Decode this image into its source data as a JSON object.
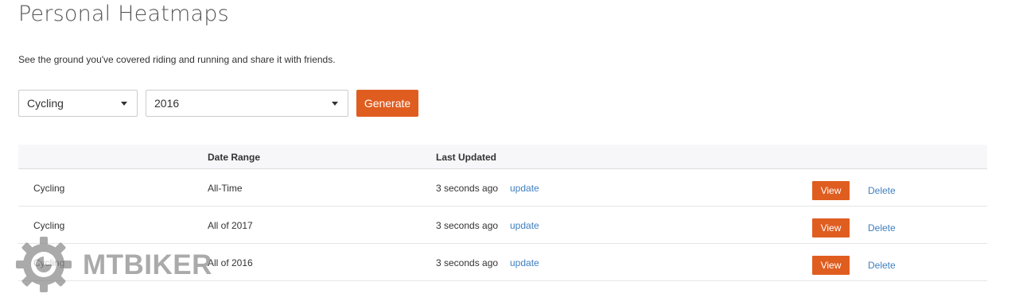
{
  "header": {
    "title": "Personal Heatmaps",
    "subtitle": "See the ground you've covered riding and running and share it with friends."
  },
  "controls": {
    "sport_value": "Cycling",
    "year_value": "2016",
    "generate_label": "Generate"
  },
  "table": {
    "columns": [
      "",
      "Date Range",
      "Last Updated"
    ],
    "rows": [
      {
        "sport": "Cycling",
        "date_range": "All-Time",
        "last_updated": "3 seconds ago",
        "update_label": "update",
        "view_label": "View",
        "delete_label": "Delete"
      },
      {
        "sport": "Cycling",
        "date_range": "All of 2017",
        "last_updated": "3 seconds ago",
        "update_label": "update",
        "view_label": "View",
        "delete_label": "Delete"
      },
      {
        "sport": "Cycling",
        "date_range": "All of 2016",
        "last_updated": "3 seconds ago",
        "update_label": "update",
        "view_label": "View",
        "delete_label": "Delete"
      }
    ]
  },
  "watermark": {
    "text": "MTBIKER",
    "icon": "gear-icon"
  },
  "colors": {
    "accent": "#e05d20",
    "link": "#3f7fbf",
    "header_bg": "#f7f7fa"
  }
}
